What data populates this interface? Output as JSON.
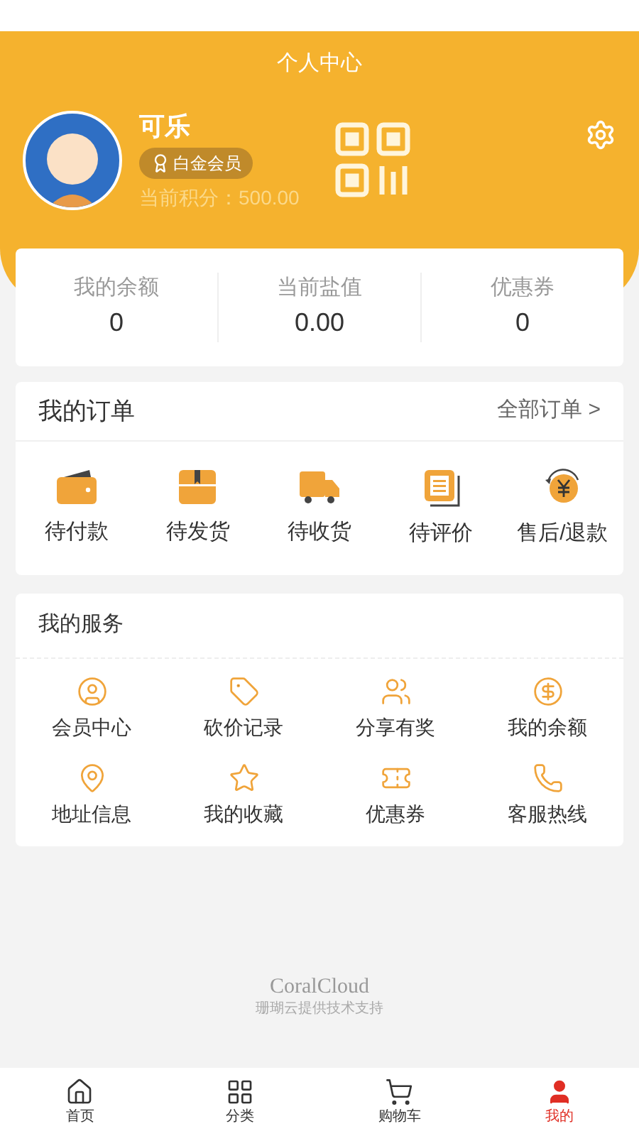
{
  "header": {
    "title": "个人中心"
  },
  "profile": {
    "name": "可乐",
    "badge": "白金会员",
    "points": "当前积分：500.00"
  },
  "stats": [
    {
      "label": "我的余额",
      "value": "0"
    },
    {
      "label": "当前盐值",
      "value": "0.00"
    },
    {
      "label": "优惠券",
      "value": "0"
    }
  ],
  "orders": {
    "title": "我的订单",
    "link": "全部订单",
    "link_arrow": ">",
    "items": [
      {
        "kind": "wallet",
        "label": "待付款"
      },
      {
        "kind": "box",
        "label": "待发货"
      },
      {
        "kind": "truck",
        "label": "待收货"
      },
      {
        "kind": "review",
        "label": "待评价"
      },
      {
        "kind": "refund",
        "label": "售后/退款"
      }
    ]
  },
  "services": {
    "title": "我的服务",
    "items": [
      {
        "kind": "member",
        "label": "会员中心"
      },
      {
        "kind": "bargain",
        "label": "砍价记录"
      },
      {
        "kind": "share",
        "label": "分享有奖"
      },
      {
        "kind": "balance",
        "label": "我的余额"
      },
      {
        "kind": "address",
        "label": "地址信息"
      },
      {
        "kind": "favorite",
        "label": "我的收藏"
      },
      {
        "kind": "coupon",
        "label": "优惠券"
      },
      {
        "kind": "hotline",
        "label": "客服热线"
      }
    ]
  },
  "footer": {
    "brand": "CoralCloud",
    "note": "珊瑚云提供技术支持"
  },
  "tabbar": [
    {
      "kind": "home",
      "label": "首页",
      "selected": false
    },
    {
      "kind": "category",
      "label": "分类",
      "selected": false
    },
    {
      "kind": "cart",
      "label": "购物车",
      "selected": false
    },
    {
      "kind": "me",
      "label": "我的",
      "selected": true
    }
  ]
}
